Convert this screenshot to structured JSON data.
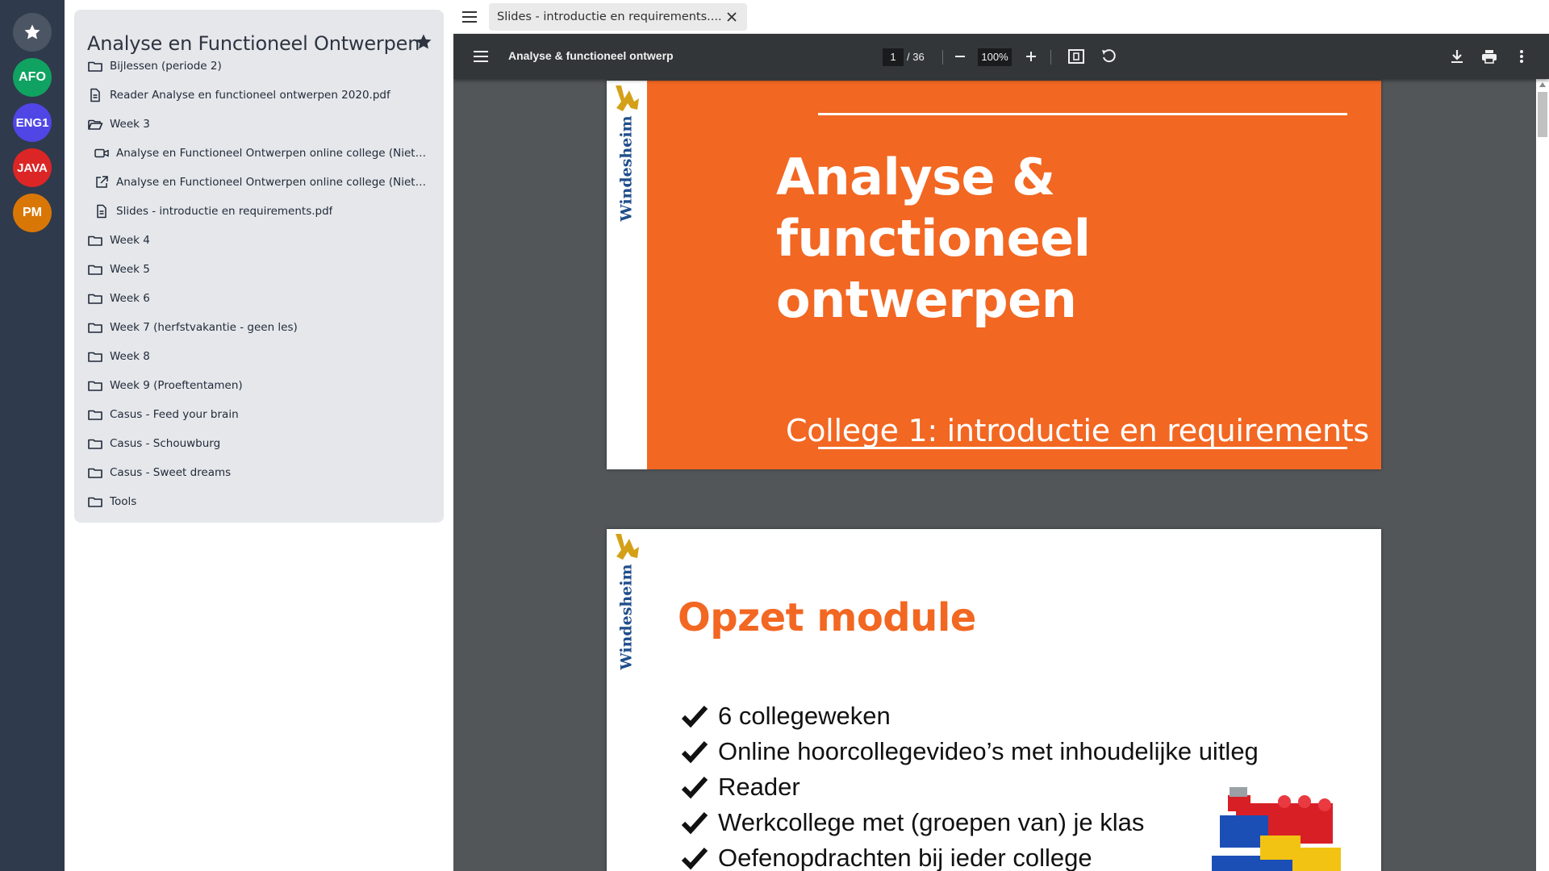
{
  "rail": {
    "items": [
      {
        "label": "",
        "icon": "star-icon",
        "color": "#4b5563"
      },
      {
        "label": "AFO",
        "color": "#10a261"
      },
      {
        "label": "ENG1",
        "color": "#4f46e5"
      },
      {
        "label": "JAVA",
        "color": "#dc2626"
      },
      {
        "label": "PM",
        "color": "#d97706"
      }
    ]
  },
  "course": {
    "title": "Analyse en Functioneel Ontwerpen",
    "items": [
      {
        "label": "Bijlessen (periode 2)",
        "icon": "folder-icon"
      },
      {
        "label": "Reader Analyse en functioneel ontwerpen 2020.pdf",
        "icon": "document-icon"
      },
      {
        "label": "Week 3",
        "icon": "folder-open-icon"
      },
      {
        "label": "Analyse en Functioneel Ontwerpen online college (Niet-)func...",
        "icon": "video-icon"
      },
      {
        "label": "Analyse en Functioneel Ontwerpen online college (Niet-)func...",
        "icon": "external-link-icon"
      },
      {
        "label": "Slides - introductie en requirements.pdf",
        "icon": "document-icon"
      },
      {
        "label": "Week 4",
        "icon": "folder-icon"
      },
      {
        "label": "Week 5",
        "icon": "folder-icon"
      },
      {
        "label": "Week 6",
        "icon": "folder-icon"
      },
      {
        "label": "Week 7 (herfstvakantie - geen les)",
        "icon": "folder-icon"
      },
      {
        "label": "Week 8",
        "icon": "folder-icon"
      },
      {
        "label": "Week 9 (Proeftentamen)",
        "icon": "folder-icon"
      },
      {
        "label": "Casus - Feed your brain",
        "icon": "folder-icon"
      },
      {
        "label": "Casus - Schouwburg",
        "icon": "folder-icon"
      },
      {
        "label": "Casus - Sweet dreams",
        "icon": "folder-icon"
      },
      {
        "label": "Tools",
        "icon": "folder-icon"
      }
    ]
  },
  "browser": {
    "tab_title": "Slides - introductie en requirements...."
  },
  "pdf": {
    "doc_title": "Analyse & functioneel ontwerp",
    "page_current": "1",
    "page_total": "/ 36",
    "zoom": "100%"
  },
  "slides": {
    "brand": "Windesheim",
    "brand_color": "#1f4e8c",
    "accent": "#f26722",
    "slide1": {
      "title_line1": "Analyse &",
      "title_line2": "functioneel ontwerpen",
      "subtitle": "College 1: introductie en requirements"
    },
    "slide2": {
      "title": "Opzet module",
      "bullets": [
        "6 collegeweken",
        "Online hoorcollegevideo’s met inhoudelijke uitleg",
        "Reader",
        "Werkcollege met (groepen van) je klas",
        "Oefenopdrachten bij ieder college"
      ]
    }
  }
}
